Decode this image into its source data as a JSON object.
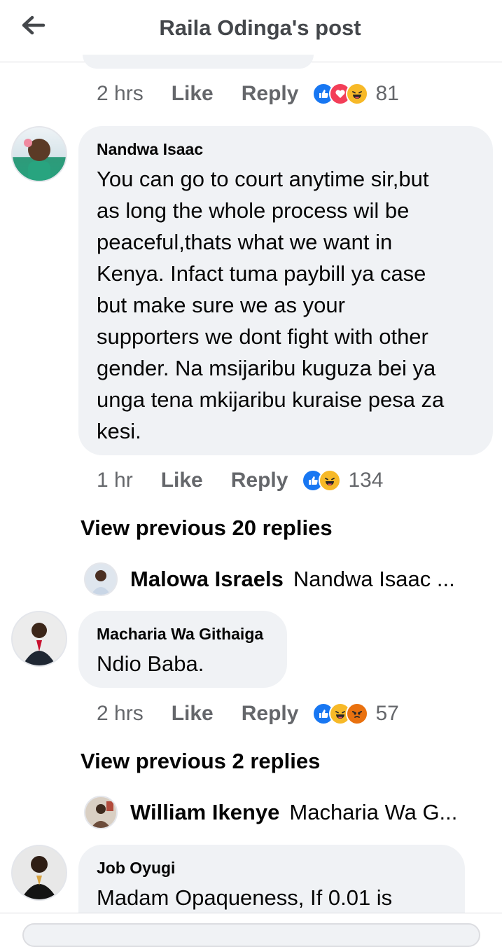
{
  "header": {
    "title": "Raila Odinga's post"
  },
  "top_actions": {
    "time": "2 hrs",
    "like": "Like",
    "reply": "Reply",
    "count": "81",
    "reactions": [
      "like-icon",
      "love-icon",
      "haha-icon"
    ]
  },
  "comments": [
    {
      "name": "Nandwa Isaac",
      "lines": [
        "You can go to court anytime sir,but",
        "as long the whole process wil be",
        "peaceful,thats what we want in",
        "Kenya. Infact tuma paybill ya case",
        "but make sure we as your",
        "supporters we dont fight with other",
        "gender. Na msijaribu kuguza bei ya",
        "unga tena mkijaribu kuraise pesa za",
        "kesi."
      ],
      "actions": {
        "time": "1 hr",
        "like": "Like",
        "reply": "Reply",
        "count": "134",
        "reactions": [
          "like-icon",
          "haha-icon"
        ]
      },
      "view_previous": "View previous 20 replies",
      "reply_preview": {
        "name": "Malowa Israels",
        "text": "Nandwa Isaac ..."
      }
    },
    {
      "name": "Macharia Wa Githaiga",
      "text": "Ndio Baba.",
      "actions": {
        "time": "2 hrs",
        "like": "Like",
        "reply": "Reply",
        "count": "57",
        "reactions": [
          "like-icon",
          "haha-icon",
          "angry-icon"
        ]
      },
      "view_previous": "View previous 2 replies",
      "reply_preview": {
        "name": "William Ikenye",
        "text": "Macharia Wa G..."
      }
    },
    {
      "name": "Job Oyugi",
      "text": "Madam Opaqueness, If 0.01 is"
    }
  ],
  "colors": {
    "like": "#1877f2",
    "love": "#f33e58",
    "haha": "#f7b928",
    "angry": "#e9710f",
    "bubble": "#f0f2f5",
    "meta": "#65676b"
  }
}
